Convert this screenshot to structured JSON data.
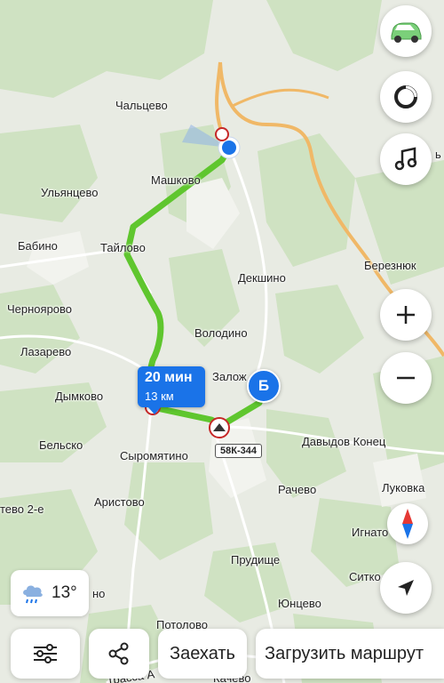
{
  "map": {
    "places": [
      {
        "name": "Чальцево"
      },
      {
        "name": "Машково"
      },
      {
        "name": "Ульянцево"
      },
      {
        "name": "Бабино"
      },
      {
        "name": "Тайлово"
      },
      {
        "name": "Черноярово"
      },
      {
        "name": "Лазарево"
      },
      {
        "name": "Дымково"
      },
      {
        "name": "Бельско"
      },
      {
        "name": "Сыромятино"
      },
      {
        "name": "Аристово"
      },
      {
        "name": "Декшино"
      },
      {
        "name": "Володино"
      },
      {
        "name": "Залож"
      },
      {
        "name": "Березнюк"
      },
      {
        "name": "Давыдов Конец"
      },
      {
        "name": "Рачево"
      },
      {
        "name": "Луковка"
      },
      {
        "name": "Игнато"
      },
      {
        "name": "Прудище"
      },
      {
        "name": "Ситко"
      },
      {
        "name": "Юнцево"
      },
      {
        "name": "Потолово"
      },
      {
        "name": "Качево"
      },
      {
        "name": "тево 2-е"
      },
      {
        "name": "но"
      },
      {
        "name": "ь"
      },
      {
        "name": "Трасса А"
      }
    ],
    "route_time": "20 мин",
    "route_distance": "13 км",
    "destination_marker": "Б",
    "road_number": "58К-344",
    "route_color": "#5fc62e",
    "accent_color": "#1a73e8"
  },
  "controls": {
    "car_icon": "car-icon",
    "recenter_icon": "alice-ring-icon",
    "music_icon": "music-note-icon",
    "zoom_in_icon": "plus-icon",
    "zoom_out_icon": "minus-icon",
    "compass_icon": "compass-icon",
    "locate_icon": "navigation-arrow-icon"
  },
  "weather": {
    "temperature": "13°",
    "icon": "rain-cloud-icon"
  },
  "bottom_bar": {
    "settings_icon": "sliders-icon",
    "share_icon": "share-icon",
    "stop_by_label": "Заехать",
    "load_route_label": "Загрузить маршрут"
  }
}
